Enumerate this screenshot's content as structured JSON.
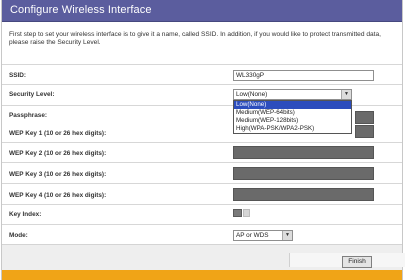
{
  "title": "Configure Wireless Interface",
  "intro": "First step to set your wireless interface is to give it a name, called SSID. In addition, if you would like to protect transmitted data, please raise the Security Level.",
  "labels": {
    "ssid": "SSID:",
    "security_level": "Security Level:",
    "passphrase": "Passphrase:",
    "wep1": "WEP Key 1 (10 or 26 hex digits):",
    "wep2": "WEP Key 2 (10 or 26 hex digits):",
    "wep3": "WEP Key 3 (10 or 26 hex digits):",
    "wep4": "WEP Key 4 (10 or 26 hex digits):",
    "key_index": "Key Index:",
    "mode": "Mode:"
  },
  "values": {
    "ssid": "WL330gP",
    "security_level": "Low(None)",
    "mode": "AP or WDS"
  },
  "security_options": [
    "Low(None)",
    "Medium(WEP-64bits)",
    "Medium(WEP-128bits)",
    "High(WPA-PSK/WPA2-PSK)"
  ],
  "buttons": {
    "finish": "Finish"
  },
  "colors": {
    "titlebar": "#5b5d9e",
    "highlight": "#2c4dbd",
    "bottom_stripe": "#f0a417"
  }
}
